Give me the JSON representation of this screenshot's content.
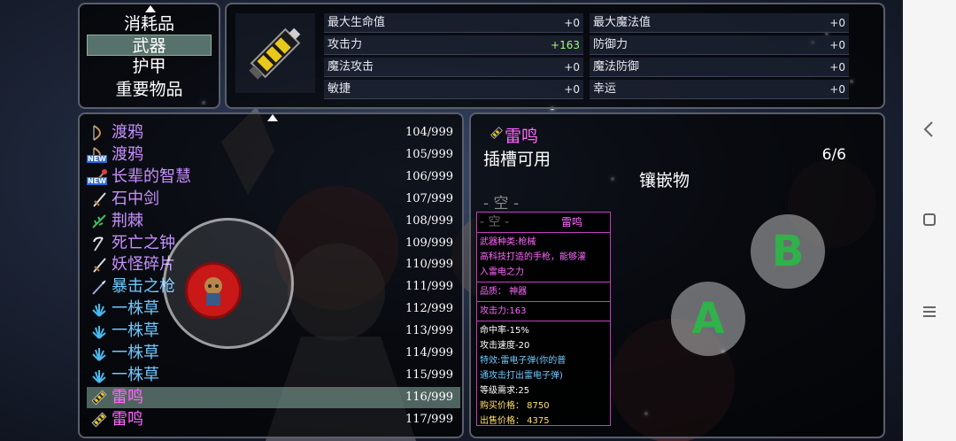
{
  "categories": {
    "items": [
      "消耗品",
      "武器",
      "护甲",
      "重要物品"
    ],
    "selected_index": 1
  },
  "stats": [
    {
      "label": "最大生命值",
      "value": "+0"
    },
    {
      "label": "最大魔法值",
      "value": "+0"
    },
    {
      "label": "攻击力",
      "value": "+163"
    },
    {
      "label": "防御力",
      "value": "+0"
    },
    {
      "label": "魔法攻击",
      "value": "+0"
    },
    {
      "label": "魔法防御",
      "value": "+0"
    },
    {
      "label": "敏捷",
      "value": "+0"
    },
    {
      "label": "幸运",
      "value": "+0"
    }
  ],
  "inventory": [
    {
      "name": "渡鸦",
      "count": "104/999",
      "color": "#c890ff",
      "icon": "bow-icon",
      "new": false
    },
    {
      "name": "渡鸦",
      "count": "105/999",
      "color": "#c890ff",
      "icon": "bow-icon",
      "new": true
    },
    {
      "name": "长辈的智慧",
      "count": "106/999",
      "color": "#c890ff",
      "icon": "staff-icon",
      "new": true
    },
    {
      "name": "石中剑",
      "count": "107/999",
      "color": "#c890ff",
      "icon": "sword-icon",
      "new": false
    },
    {
      "name": "荆棘",
      "count": "108/999",
      "color": "#c890ff",
      "icon": "thorn-icon",
      "new": false
    },
    {
      "name": "死亡之钟",
      "count": "109/999",
      "color": "#c890ff",
      "icon": "scythe-icon",
      "new": false
    },
    {
      "name": "妖怪碎片",
      "count": "110/999",
      "color": "#c890ff",
      "icon": "sword-icon",
      "new": false
    },
    {
      "name": "暴击之枪",
      "count": "111/999",
      "color": "#6fc8ff",
      "icon": "spear-icon",
      "new": false
    },
    {
      "name": "一株草",
      "count": "112/999",
      "color": "#6fc8ff",
      "icon": "grass-icon",
      "new": false
    },
    {
      "name": "一株草",
      "count": "113/999",
      "color": "#6fc8ff",
      "icon": "grass-icon",
      "new": false
    },
    {
      "name": "一株草",
      "count": "114/999",
      "color": "#6fc8ff",
      "icon": "grass-icon",
      "new": false
    },
    {
      "name": "一株草",
      "count": "115/999",
      "color": "#6fc8ff",
      "icon": "grass-icon",
      "new": false
    },
    {
      "name": "雷鸣",
      "count": "116/999",
      "color": "#ff66ff",
      "icon": "gun-icon",
      "new": false
    },
    {
      "name": "雷鸣",
      "count": "117/999",
      "color": "#ff66ff",
      "icon": "gun-icon",
      "new": false
    }
  ],
  "selected_row": 12,
  "new_tag": "NEW",
  "detail": {
    "title": "雷鸣",
    "socket_label": "插槽可用",
    "socket_count": "6/6",
    "inlay_label": "镶嵌物",
    "empty_label": "- 空 -"
  },
  "tooltip": {
    "header_empty": "- 空 -",
    "header_name": "雷鸣",
    "type_line": "武器种类:枪械",
    "desc_line1": "高科技打造的手枪，能够灌",
    "desc_line2": "入雷电之力",
    "quality": "品质： 神器",
    "attack": "攻击力:163",
    "hit_rate": "命中率-15%",
    "attack_speed": "攻击速度-20",
    "special_line1": "特效:雷电子弹(你的普",
    "special_line2": "通攻击打出雷电子弹)",
    "level_req": "等级需求:25",
    "buy_price": "购买价格： 8750",
    "sell_price": "出售价格： 4375"
  },
  "controls": {
    "a_label": "A",
    "b_label": "B"
  },
  "colors": {
    "selected_bg": "#57726a",
    "tooltip_border": "#c040c0",
    "button_text": "#2fb24a",
    "joystick": "#c81818"
  }
}
